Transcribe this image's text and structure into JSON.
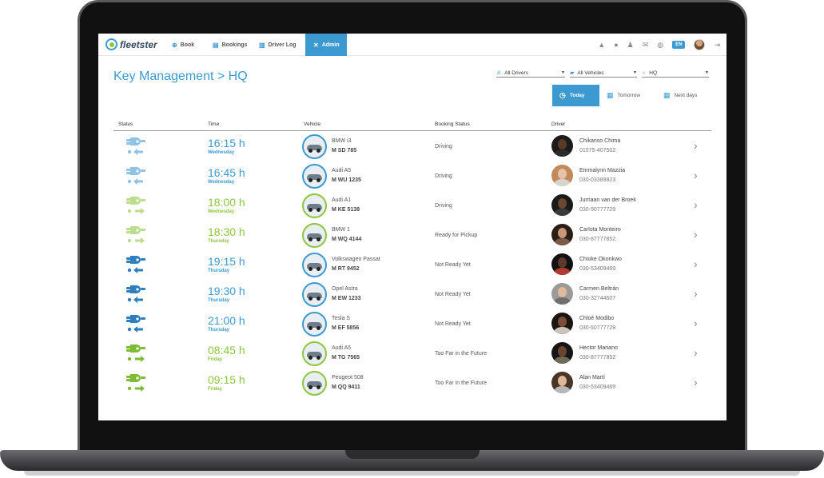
{
  "nav": {
    "logo": "fleetster",
    "items": [
      {
        "label": "Book",
        "icon": "plus-circle-icon"
      },
      {
        "label": "Bookings",
        "icon": "list-icon"
      },
      {
        "label": "Driver Log",
        "icon": "logbook-icon"
      },
      {
        "label": "Admin",
        "icon": "wrench-icon"
      }
    ],
    "language": "EN"
  },
  "page": {
    "title": "Key Management > HQ"
  },
  "filters": {
    "drivers": "All Drivers",
    "vehicles": "All Vehicles",
    "location": "HQ"
  },
  "day_tabs": {
    "today": "Today",
    "tomorrow": "Tomorrow",
    "next_days": "Next days"
  },
  "table": {
    "headers": {
      "status": "Status",
      "time": "Time",
      "vehicle": "Vehicle",
      "booking_status": "Booking Status",
      "driver": "Driver"
    },
    "rows": [
      {
        "key_state": "pale-return",
        "time": "16:15 h",
        "day": "Wednesday",
        "time_color": "blue",
        "vehicle": "BMW i3",
        "plate": "M SD 785",
        "booking_status": "Driving",
        "driver": "Chikanso Chima",
        "phone": "01575-407502",
        "skin": "#5a3a28",
        "hair": "#1b1b1b",
        "shirt": "#2b2b2b"
      },
      {
        "key_state": "pale-return",
        "time": "16:45 h",
        "day": "Wednesday",
        "time_color": "blue",
        "vehicle": "Audi A5",
        "plate": "M WU 1235",
        "booking_status": "Driving",
        "driver": "Emmalynn Mazzia",
        "phone": "030-03389923",
        "skin": "#e6c3a8",
        "hair": "#c08a5a",
        "shirt": "#d7d3cf"
      },
      {
        "key_state": "pale-out",
        "time": "18:00 h",
        "day": "Wednesday",
        "time_color": "green",
        "vehicle": "Audi A1",
        "plate": "M KE 5138",
        "booking_status": "Driving",
        "driver": "Jurriaan van der Broek",
        "phone": "030-50777729",
        "skin": "#6b4630",
        "hair": "#1a1a1a",
        "shirt": "#3a3a3a"
      },
      {
        "key_state": "pale-out",
        "time": "18:30 h",
        "day": "Thursday",
        "time_color": "green",
        "vehicle": "BMW 1",
        "plate": "M WQ 4144",
        "booking_status": "Ready for Pickup",
        "driver": "Carlota Monteiro",
        "phone": "030-87777852",
        "skin": "#c89878",
        "hair": "#2a1e17",
        "shirt": "#7a5a48"
      },
      {
        "key_state": "return",
        "time": "19:15 h",
        "day": "Thursday",
        "time_color": "blue",
        "vehicle": "Volkswagen Passat",
        "plate": "M RT 9452",
        "booking_status": "Not Ready Yet",
        "driver": "Chioke Okonkwo",
        "phone": "030-53409469",
        "skin": "#5a3a2a",
        "hair": "#111111",
        "shirt": "#b33a2f"
      },
      {
        "key_state": "return",
        "time": "19:30 h",
        "day": "Thursday",
        "time_color": "blue",
        "vehicle": "Opel Astra",
        "plate": "M EW 1233",
        "booking_status": "Not Ready Yet",
        "driver": "Carmen Beltrán",
        "phone": "030-32744607",
        "skin": "#e2b99a",
        "hair": "#9a9a9a",
        "shirt": "#6f6f6f"
      },
      {
        "key_state": "return",
        "time": "21:00 h",
        "day": "Thursday",
        "time_color": "blue",
        "vehicle": "Tesla S",
        "plate": "M EF 5856",
        "booking_status": "Not Ready Yet",
        "driver": "Chloé Modibo",
        "phone": "030-50777729",
        "skin": "#7a4e36",
        "hair": "#1c1410",
        "shirt": "#c9c3bd"
      },
      {
        "key_state": "out",
        "time": "08:45 h",
        "day": "Friday",
        "time_color": "green",
        "vehicle": "Audi A5",
        "plate": "M TG 7565",
        "booking_status": "Too Far in the Future",
        "driver": "Hector Mariano",
        "phone": "030-87777852",
        "skin": "#6a4531",
        "hair": "#151515",
        "shirt": "#6d6a5a"
      },
      {
        "key_state": "out",
        "time": "09:15 h",
        "day": "Friday",
        "time_color": "green",
        "vehicle": "Peugeot 508",
        "plate": "M QQ 9411",
        "booking_status": "Too Far in the Future",
        "driver": "Alan Martí",
        "phone": "030-53409469",
        "skin": "#e0b899",
        "hair": "#4a3426",
        "shirt": "#b8b8b8"
      }
    ]
  }
}
